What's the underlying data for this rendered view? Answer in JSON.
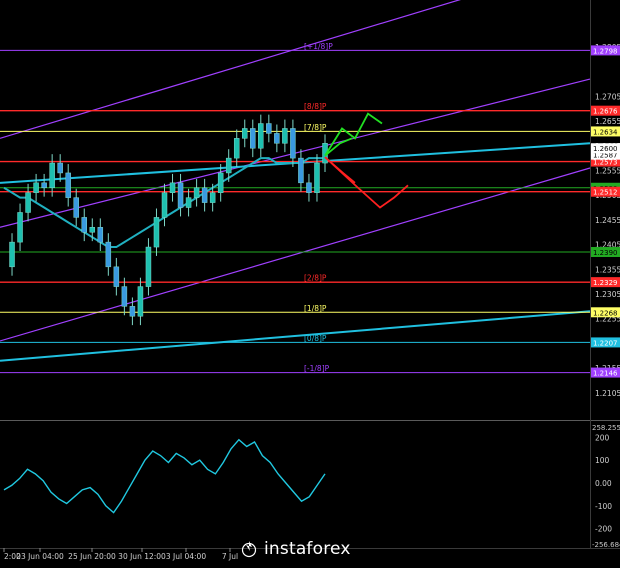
{
  "brand": {
    "name": "instaforex"
  },
  "chart_data": [
    {
      "type": "candlestick",
      "pane": "price",
      "y_range": [
        1.205,
        1.29
      ],
      "price_axis_ticks": [
        "1.2805",
        "1.2705",
        "1.2655",
        "1.2605",
        "1.2555",
        "1.2505",
        "1.2455",
        "1.2405",
        "1.2355",
        "1.2305",
        "1.2255",
        "1.2205",
        "1.2155",
        "1.2105"
      ],
      "murrey_levels": [
        {
          "label": "[8/8]P",
          "price": 1.2676,
          "price_label": "1.2676",
          "color": "#ff2a2a"
        },
        {
          "label": "[7/8]P",
          "price": 1.2634,
          "price_label": "1.2634",
          "color": "#ffff66"
        },
        {
          "label": "",
          "price": 1.2573,
          "price_label": "1.2573",
          "color": "#ff2a2a"
        },
        {
          "label": "",
          "price": 1.252,
          "price_label": "1.2520",
          "color": "#22aa22"
        },
        {
          "label": "",
          "price": 1.2512,
          "price_label": "1.2512",
          "color": "#ff2a2a"
        },
        {
          "label": "",
          "price": 1.239,
          "price_label": "1.2390",
          "color": "#22aa22"
        },
        {
          "label": "[2/8]P",
          "price": 1.2329,
          "price_label": "1.2329",
          "color": "#ff2a2a"
        },
        {
          "label": "[1/8]P",
          "price": 1.2268,
          "price_label": "1.2268",
          "color": "#ffff66"
        },
        {
          "label": "[0/8]P",
          "price": 1.2207,
          "price_label": "1.2207",
          "color": "#20c0e0"
        },
        {
          "label": "[-1/8]P",
          "price": 1.2146,
          "price_label": "1.2146",
          "color": "#a040ff"
        },
        {
          "label": "[+1/8]P",
          "price": 1.2798,
          "price_label": "1.2798",
          "color": "#a040ff"
        }
      ],
      "current_price_tags": [
        {
          "price": 1.2587,
          "label": "1.2587",
          "color": "#ffffff"
        },
        {
          "price": 1.26,
          "label": "1.2600",
          "color": "#ffffff"
        }
      ],
      "time_axis_labels": [
        "2:00",
        "23 Jun 04:00",
        "25 Jun 20:00",
        "30 Jun 12:00",
        "3 Jul 04:00",
        "7 Jul"
      ],
      "close": [
        1.236,
        1.241,
        1.247,
        1.251,
        1.253,
        1.252,
        1.257,
        1.255,
        1.25,
        1.246,
        1.243,
        1.244,
        1.241,
        1.236,
        1.232,
        1.228,
        1.226,
        1.232,
        1.24,
        1.246,
        1.251,
        1.253,
        1.248,
        1.25,
        1.252,
        1.249,
        1.251,
        1.255,
        1.258,
        1.262,
        1.264,
        1.26,
        1.265,
        1.263,
        1.261,
        1.264,
        1.258,
        1.253,
        1.251,
        1.257,
        1.261
      ],
      "ma": [
        1.252,
        1.251,
        1.25,
        1.25,
        1.249,
        1.248,
        1.247,
        1.246,
        1.245,
        1.244,
        1.243,
        1.242,
        1.241,
        1.24,
        1.24,
        1.241,
        1.242,
        1.243,
        1.244,
        1.245,
        1.246,
        1.247,
        1.248,
        1.249,
        1.25,
        1.251,
        1.252,
        1.253,
        1.254,
        1.255,
        1.256,
        1.257,
        1.258,
        1.258,
        1.257,
        1.257,
        1.257,
        1.257,
        1.258,
        1.258,
        1.258
      ],
      "channel_lines": [
        {
          "color": "#a040ff",
          "y_start": 1.262,
          "y_end": 1.298
        },
        {
          "color": "#a040ff",
          "y_start": 1.244,
          "y_end": 1.274
        },
        {
          "color": "#a040ff",
          "y_start": 1.221,
          "y_end": 1.256
        },
        {
          "color": "#20c0e0",
          "y_start": 1.253,
          "y_end": 1.261
        },
        {
          "color": "#20c0e0",
          "y_start": 1.217,
          "y_end": 1.227
        }
      ]
    },
    {
      "type": "line",
      "pane": "cci",
      "y_range": [
        -250,
        250
      ],
      "ticks": [
        "200",
        "100",
        "0.00",
        "-100",
        "-200"
      ],
      "corner_top": "258.2554",
      "corner_bottom": "-256.684",
      "values": [
        -30,
        -10,
        20,
        60,
        40,
        10,
        -40,
        -70,
        -90,
        -60,
        -30,
        -20,
        -50,
        -100,
        -130,
        -80,
        -20,
        40,
        100,
        140,
        120,
        90,
        130,
        110,
        80,
        100,
        60,
        40,
        90,
        150,
        190,
        160,
        180,
        120,
        90,
        40,
        0,
        -40,
        -80,
        -60,
        -10,
        40
      ]
    }
  ],
  "projections": [
    {
      "color": "#22e022"
    },
    {
      "color": "#ff2020"
    }
  ]
}
